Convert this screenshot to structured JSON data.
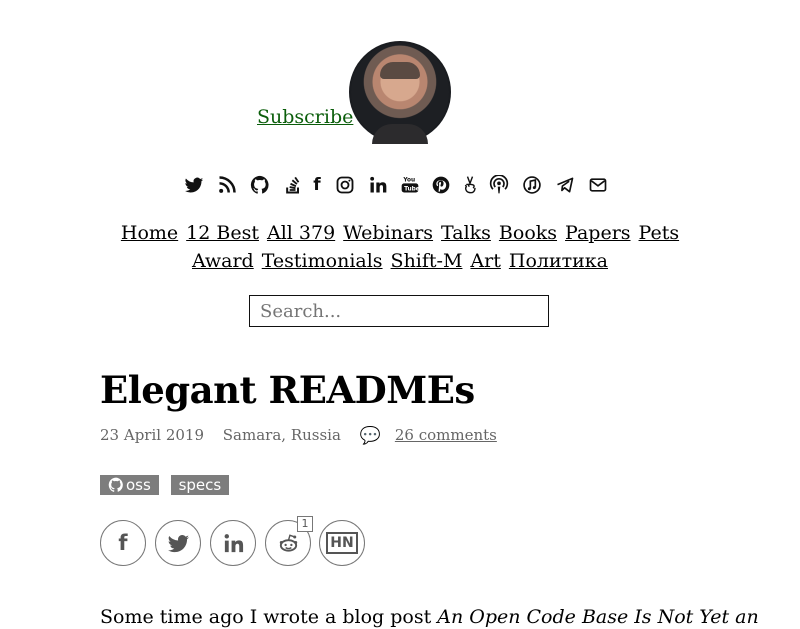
{
  "header": {
    "subscribe": "Subscribe",
    "search_placeholder": "Search..."
  },
  "social_icons": [
    "twitter-icon",
    "rss-icon",
    "github-icon",
    "stackoverflow-icon",
    "facebook-icon",
    "instagram-icon",
    "linkedin-icon",
    "youtube-icon",
    "pinterest-icon",
    "angellist-icon",
    "podcast-icon",
    "music-icon",
    "telegram-icon",
    "email-icon"
  ],
  "nav": {
    "items": [
      "Home",
      "12 Best",
      "All 379",
      "Webinars",
      "Talks",
      "Books",
      "Papers",
      "Pets",
      "Award",
      "Testimonials",
      "Shift-M",
      "Art",
      "Политика"
    ]
  },
  "post": {
    "title": "Elegant READMEs",
    "date": "23 April 2019",
    "location": "Samara, Russia",
    "comments": "26 comments",
    "tags": [
      "oss",
      "specs"
    ],
    "share_count": "1",
    "intro": "Some time ago I wrote a blog post ",
    "intro_italic": "An Open Code Base Is Not Yet an"
  }
}
